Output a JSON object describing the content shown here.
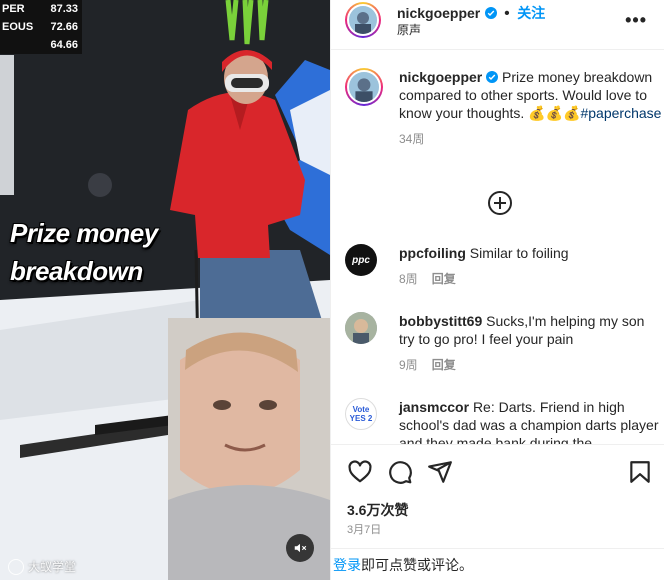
{
  "media": {
    "scoreboard": [
      {
        "name": "PER",
        "score": "87.33"
      },
      {
        "name": "EOUS",
        "score": "72.66"
      },
      {
        "name": "",
        "score": "64.66"
      }
    ],
    "caption_line1": "Prize money",
    "caption_line2": "breakdown",
    "watermark": "大蚁学堂"
  },
  "header": {
    "username": "nickgoepper",
    "separator": "•",
    "follow_label": "关注",
    "audio_label": "原声"
  },
  "caption_post": {
    "username": "nickgoepper",
    "text": "Prize money breakdown compared to other sports. Would love to know your thoughts. 💰💰💰",
    "hashtag": "#paperchase",
    "age": "34周"
  },
  "comments": [
    {
      "username": "ppcfoiling",
      "text": "Similar to foiling",
      "age": "8周",
      "reply_label": "回复",
      "avatar_text": "ppc"
    },
    {
      "username": "bobbystitt69",
      "text": "Sucks,I'm helping my son try to go pro! I feel your pain",
      "age": "9周",
      "reply_label": "回复",
      "avatar_text": ""
    },
    {
      "username": "jansmccor",
      "text": "Re: Darts. Friend in high school's dad was a champion darts player and they made bank during the",
      "age": "",
      "reply_label": "",
      "avatar_text": "Vote YES 2"
    }
  ],
  "stats": {
    "likes": "3.6万次赞",
    "date": "3月7日"
  },
  "login_bar": {
    "login_link": "登录",
    "text": "即可点赞或评论。"
  },
  "colors": {
    "accent": "#0095f6",
    "muted": "#8e8e8e",
    "hoodie": "#d9262b",
    "verified": "#0095f6"
  },
  "icons": [
    "heart-icon",
    "comment-icon",
    "share-icon",
    "bookmark-icon",
    "more-icon",
    "mute-icon",
    "add-circle-icon",
    "verified-icon"
  ]
}
